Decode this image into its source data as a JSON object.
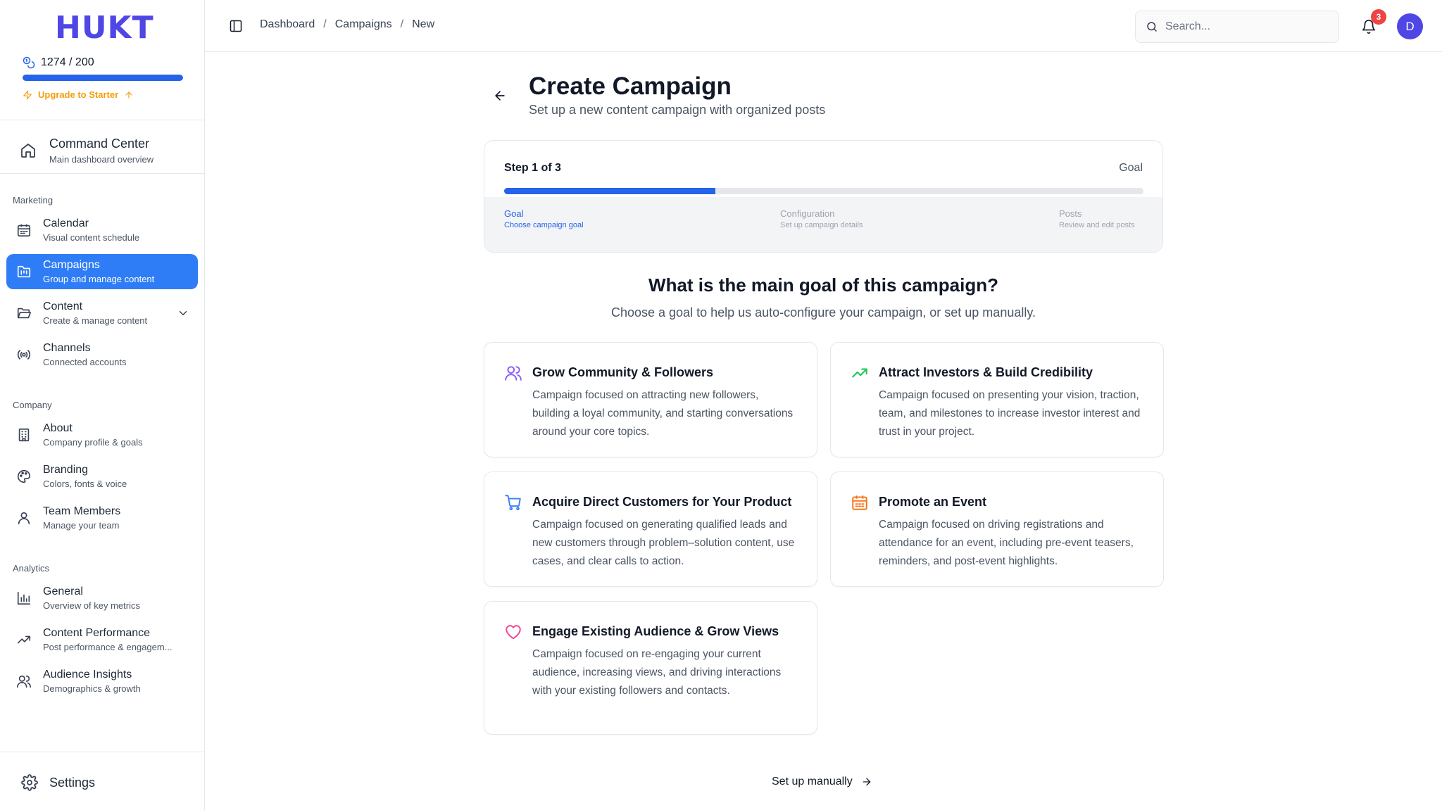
{
  "sidebar": {
    "logo": "HUKT",
    "credits": {
      "text": "1274 / 200",
      "progress_pct": 100
    },
    "upgrade_label": "Upgrade to Starter",
    "command_center": {
      "title": "Command Center",
      "subtitle": "Main dashboard overview"
    },
    "groups": {
      "marketing": "Marketing",
      "company": "Company",
      "analytics": "Analytics"
    },
    "items": [
      {
        "title": "Calendar",
        "subtitle": "Visual content schedule",
        "icon": "calendar-icon"
      },
      {
        "title": "Campaigns",
        "subtitle": "Group and manage content",
        "icon": "folder-kanban-icon",
        "active": true
      },
      {
        "title": "Content",
        "subtitle": "Create & manage content",
        "icon": "folder-open-icon"
      },
      {
        "title": "Channels",
        "subtitle": "Connected accounts",
        "icon": "radio-icon"
      },
      {
        "title": "About",
        "subtitle": "Company profile & goals",
        "icon": "building-icon"
      },
      {
        "title": "Branding",
        "subtitle": "Colors, fonts & voice",
        "icon": "palette-icon"
      },
      {
        "title": "Team Members",
        "subtitle": "Manage your team",
        "icon": "user-icon"
      },
      {
        "title": "General",
        "subtitle": "Overview of key metrics",
        "icon": "bar-chart-icon"
      },
      {
        "title": "Content Performance",
        "subtitle": "Post performance & engagem...",
        "icon": "trending-up-icon"
      },
      {
        "title": "Audience Insights",
        "subtitle": "Demographics & growth",
        "icon": "users-icon"
      }
    ],
    "settings_label": "Settings"
  },
  "header": {
    "breadcrumbs": [
      "Dashboard",
      "Campaigns",
      "New"
    ],
    "search_placeholder": "Search...",
    "notification_count": "3",
    "avatar_initial": "D"
  },
  "main": {
    "title": "Create Campaign",
    "subtitle": "Set up a new content campaign with organized posts",
    "stepper": {
      "step_label": "Step 1 of 3",
      "current_name": "Goal",
      "progress_pct": 33,
      "steps": [
        {
          "name": "Goal",
          "desc": "Choose campaign goal"
        },
        {
          "name": "Configuration",
          "desc": "Set up campaign details"
        },
        {
          "name": "Posts",
          "desc": "Review and edit posts"
        }
      ]
    },
    "question": "What is the main goal of this campaign?",
    "question_sub": "Choose a goal to help us auto-configure your campaign, or set up manually.",
    "goals": [
      {
        "title": "Grow Community & Followers",
        "desc": "Campaign focused on attracting new followers, building a loyal community, and starting conversations around your core topics.",
        "icon": "users-icon",
        "color": "#8b5cf6"
      },
      {
        "title": "Attract Investors & Build Credibility",
        "desc": "Campaign focused on presenting your vision, traction, team, and milestones to increase investor interest and trust in your project.",
        "icon": "trending-up-icon",
        "color": "#22c55e"
      },
      {
        "title": "Acquire Direct Customers for Your Product",
        "desc": "Campaign focused on generating qualified leads and new customers through problem–solution content, use cases, and clear calls to action.",
        "icon": "shopping-cart-icon",
        "color": "#3b82f6"
      },
      {
        "title": "Promote an Event",
        "desc": "Campaign focused on driving registrations and attendance for an event, including pre-event teasers, reminders, and post-event highlights.",
        "icon": "calendar-icon",
        "color": "#f97316"
      },
      {
        "title": "Engage Existing Audience & Grow Views",
        "desc": "Campaign focused on re-engaging your current audience, increasing views, and driving interactions with your existing followers and contacts.",
        "icon": "heart-icon",
        "color": "#ec4899"
      }
    ],
    "manual_label": "Set up manually"
  },
  "colors": {
    "brand": "#4f46e5",
    "accent": "#2563eb",
    "active_nav": "#2f7df6",
    "upgrade": "#f59e0b",
    "badge": "#ef4444"
  }
}
